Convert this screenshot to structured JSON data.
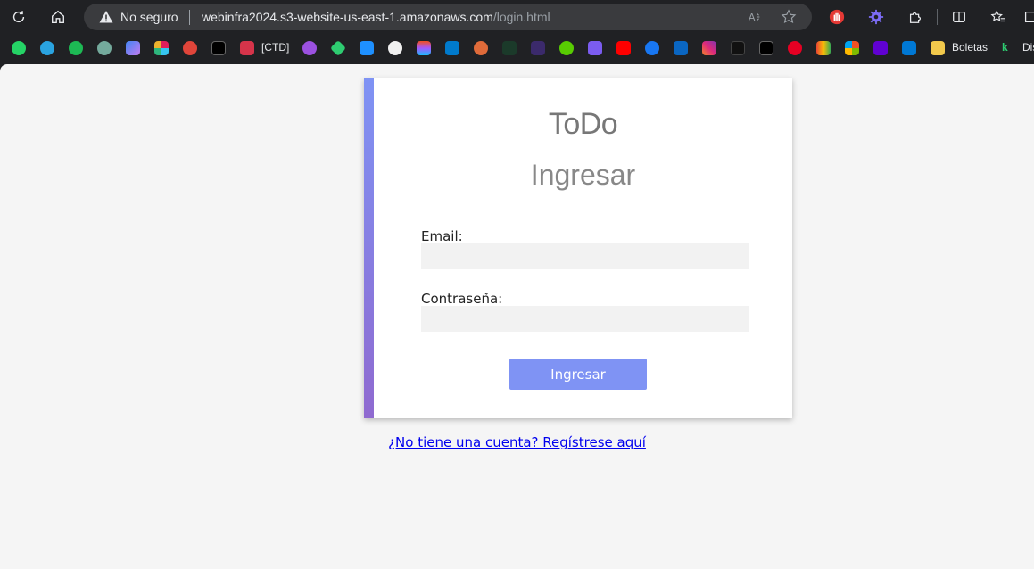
{
  "browser": {
    "security_label": "No seguro",
    "url_host": "webinfra2024.s3-website-us-east-1.amazonaws.com",
    "url_path": "/login.html"
  },
  "bookmarks": {
    "ctd_label": "[CTD]",
    "boletas_label": "Boletas",
    "overflow_label": "Dis"
  },
  "page": {
    "app_title": "ToDo",
    "heading": "Ingresar",
    "email_label": "Email:",
    "email_value": "",
    "password_label": "Contraseña:",
    "password_value": "",
    "submit_label": "Ingresar",
    "register_link": "¿No tiene una cuenta? Regístrese aquí"
  },
  "colors": {
    "accent": "#7f93f4",
    "accent_gradient_end": "#8f6ad0",
    "background": "#f5f5f5"
  }
}
